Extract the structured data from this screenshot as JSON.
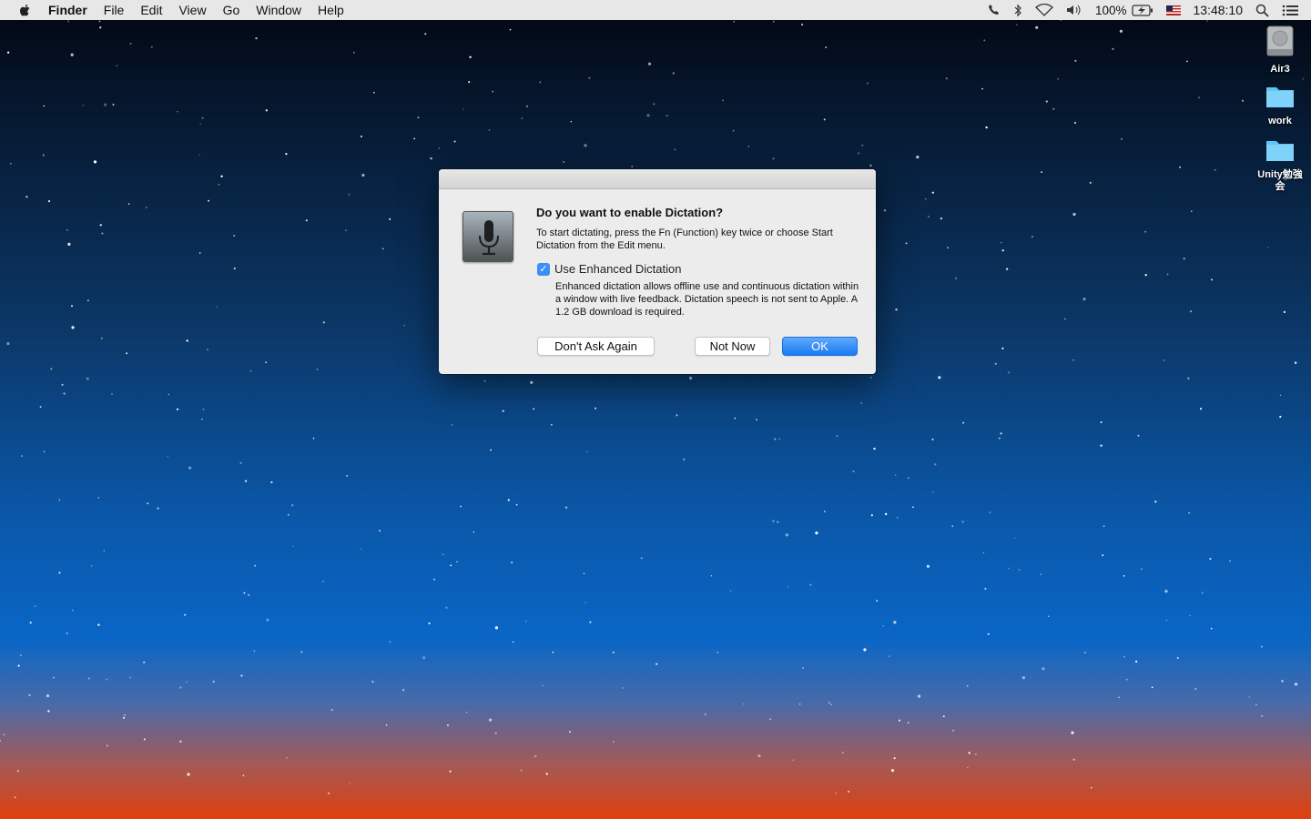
{
  "menubar": {
    "app": "Finder",
    "items": [
      "File",
      "Edit",
      "View",
      "Go",
      "Window",
      "Help"
    ],
    "battery": "100%",
    "clock": "13:48:10"
  },
  "desktop": {
    "icons": [
      {
        "label": "Air3",
        "type": "drive-icon"
      },
      {
        "label": "work",
        "type": "folder-icon"
      },
      {
        "label": "Unity勉強会",
        "type": "folder-icon"
      }
    ]
  },
  "dialog": {
    "title": "Do you want to enable Dictation?",
    "message": "To start dictating, press the Fn (Function) key twice or choose Start Dictation from the Edit menu.",
    "checkbox_label": "Use Enhanced Dictation",
    "checkbox_checked": true,
    "detail": "Enhanced dictation allows offline use and continuous dictation within a window with live feedback. Dictation speech is not sent to Apple. A 1.2 GB download is required.",
    "buttons": {
      "dont_ask": "Don't Ask Again",
      "not_now": "Not Now",
      "ok": "OK"
    }
  },
  "colors": {
    "accent": "#1a7bf5",
    "folder": "#5ec6f5"
  }
}
